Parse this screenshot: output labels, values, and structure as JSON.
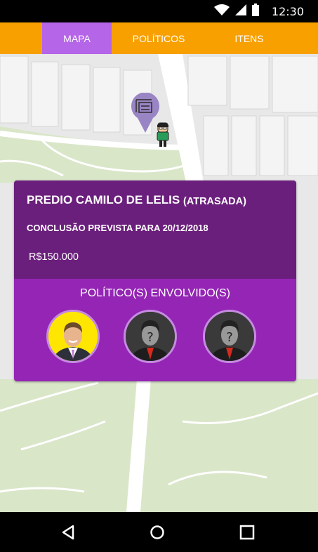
{
  "status_bar": {
    "time": "12:30"
  },
  "tabs": [
    {
      "label": "MAPA",
      "active": true
    },
    {
      "label": "POLÍTICOS",
      "active": false
    },
    {
      "label": "ITENS",
      "active": false
    }
  ],
  "map": {
    "marker_icon": "construction-site-icon",
    "user_icon": "person-icon"
  },
  "card": {
    "title": "PREDIO CAMILO DE LELIS",
    "status": "(ATRASADA)",
    "deadline": "CONCLUSÃO PREVISTA PARA 20/12/2018",
    "value": "R$150.000",
    "politicians_heading": "POLÍTICO(S) ENVOLVIDO(S)",
    "politicians": [
      {
        "name": "politician-photo",
        "background": "#ffe600"
      },
      {
        "name": "unknown-politician",
        "background": "#3a3a3a"
      },
      {
        "name": "unknown-politician",
        "background": "#3a3a3a"
      }
    ]
  },
  "colors": {
    "tab_bar": "#f7a000",
    "tab_active": "#b565e8",
    "card_top": "#6b1f7c",
    "card_bottom": "#9425b5"
  }
}
